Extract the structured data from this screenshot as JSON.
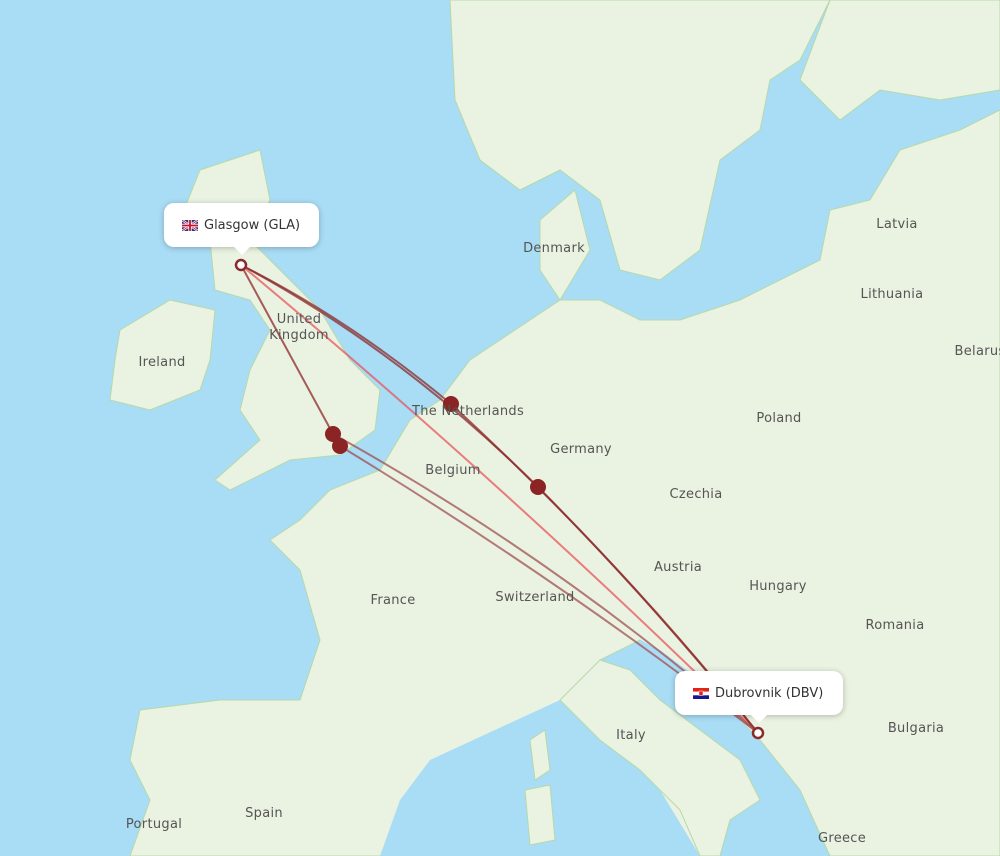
{
  "origin": {
    "label": "Glasgow (GLA)",
    "flag": "uk-flag-icon"
  },
  "destination": {
    "label": "Dubrovnik (DBV)",
    "flag": "croatia-flag-icon"
  },
  "countries": [
    "Latvia",
    "Lithuania",
    "Belarus",
    "Denmark",
    "United Kingdom",
    "Ireland",
    "The Netherlands",
    "Poland",
    "Germany",
    "Belgium",
    "Czechia",
    "Austria",
    "Hungary",
    "Romania",
    "France",
    "Switzerland",
    "Italy",
    "Bulgaria",
    "Spain",
    "Portugal",
    "Greece"
  ],
  "colors": {
    "sea": "#a9dcf5",
    "land": "#eaf2e1",
    "route": "#8b2a2a",
    "route_direct": "#e8545a",
    "stop": "#8b2424"
  }
}
